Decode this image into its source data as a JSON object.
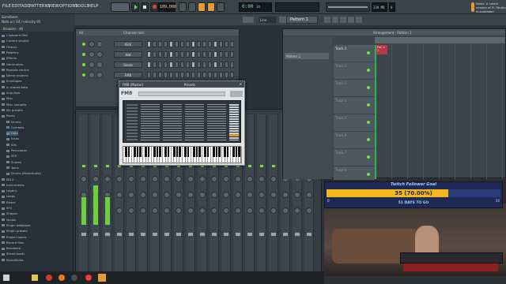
{
  "menu": [
    "FILE",
    "EDIT",
    "ADD",
    "PATTERNS",
    "VIEW",
    "OPTIONS",
    "TOOLS",
    "HELP"
  ],
  "transport": {
    "tempo": "109.000",
    "time": "0:00",
    "time_sub": "34",
    "pattern": "Pattern 1",
    "line": "Line",
    "cpu": "230 MB",
    "cpu2": "0"
  },
  "hint": {
    "title": "Sumilbees",
    "line2": "Note on: E4 / velocity 95"
  },
  "news": {
    "text": "News: A newer version of FL Studio is available!"
  },
  "browser": {
    "header": "Browser - All",
    "items": [
      "Clipboard files",
      "Current project",
      "History",
      "Patterns",
      "Effects",
      "Generators",
      "Remote control",
      "Demo projects",
      "Envelopes",
      "IL shared data",
      "Impulses",
      "Misc",
      "Misc samples",
      "My presets",
      "Packs",
      "Drums",
      "Cymbals",
      "Hats",
      "Kicks",
      "Kits",
      "Percussion",
      "SFX",
      "Snares",
      "Toms",
      "Drums (ModeAudio)",
      "DLLS",
      "Instruments",
      "Legacy",
      "Loops",
      "Risers",
      "SFX",
      "Shapes",
      "Vocals",
      "Plugin database",
      "Plugin presets",
      "Project bones",
      "Recent files",
      "Rendered",
      "Sliced beats",
      "Soundfonts"
    ]
  },
  "rack": {
    "title": "Channel rack",
    "filter": "All",
    "channels": [
      {
        "name": "Kick"
      },
      {
        "name": "Hat"
      },
      {
        "name": "Snare"
      },
      {
        "name": "FM8"
      }
    ]
  },
  "plugin": {
    "title": "FM8 (Master)",
    "presets": "Presets",
    "logo": "FM8"
  },
  "playlist": {
    "title": "Arrangement - Pattern 1",
    "pattern_item": "Pattern 1",
    "tracks": [
      "Track 1",
      "Track 2",
      "Track 3",
      "Track 4",
      "Track 5",
      "Track 6",
      "Track 7",
      "Track 8"
    ],
    "clip": "Pat..n 1"
  },
  "stream": {
    "goal_title": "Twitch Follower Goal",
    "goal_value": "35 (70.00%)",
    "goal_left": "0",
    "goal_right": "50",
    "days": "51 DAYS TO GO",
    "progress": 0.7
  },
  "colors": {
    "accent": "#f0a030",
    "bar_fill": "#f5b81c",
    "bg_dark": "#2b3237",
    "led_green": "#7ddc3a"
  }
}
